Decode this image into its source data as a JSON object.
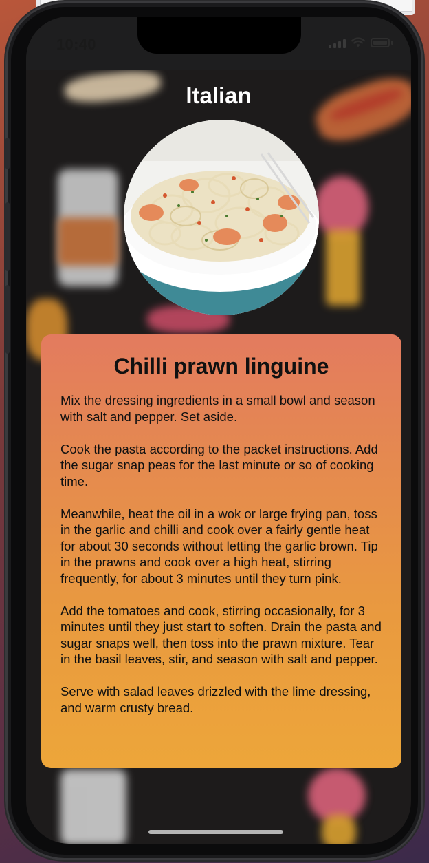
{
  "status_bar": {
    "time": "10:40"
  },
  "header": {
    "title": "Italian"
  },
  "recipe": {
    "title": "Chilli prawn linguine",
    "paragraphs": [
      "Mix the dressing ingredients in a small bowl and season with salt and pepper. Set aside.",
      "Cook the pasta according to the packet instructions. Add the sugar snap peas for the last minute or so of cooking time.",
      "Meanwhile, heat the oil in a wok or large frying pan, toss in the garlic and chilli and cook over a fairly gentle heat for about 30 seconds without letting the garlic brown. Tip in the prawns and cook over a high heat, stirring frequently, for about 3 minutes until they turn pink.",
      "Add the tomatoes and cook, stirring occasionally, for 3 minutes until they just start to soften. Drain the pasta and sugar snaps well, then toss into the prawn mixture. Tear in the basil leaves, stir, and season with salt and pepper.",
      "Serve with salad leaves drizzled with the lime dressing, and warm crusty bread."
    ]
  },
  "icons": {
    "wifi": "wifi-icon",
    "battery": "battery-icon",
    "signal": "cellular-signal-icon"
  },
  "colors": {
    "card_top": "#e37b5f",
    "card_bottom": "#eda63a",
    "screen_bg": "#1d1b1b"
  }
}
